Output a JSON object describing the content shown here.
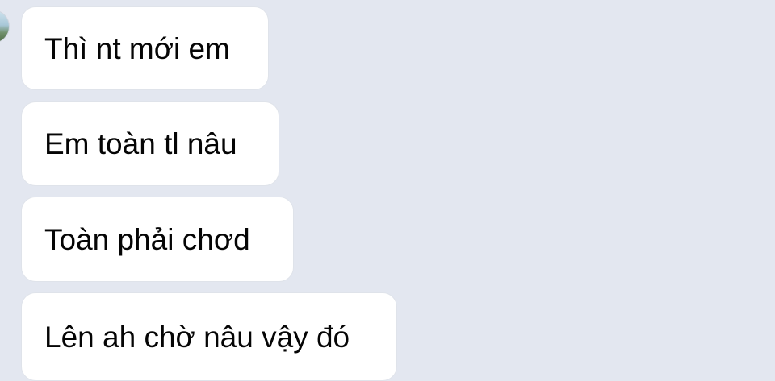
{
  "messages": [
    {
      "text": "Thì nt mới em"
    },
    {
      "text": "Em toàn tl nâu"
    },
    {
      "text": "Toàn phải chơd"
    },
    {
      "text": "Lên ah chờ nâu vậy đó"
    }
  ],
  "colors": {
    "background": "#e3e7f0",
    "bubble": "#ffffff",
    "text": "#050505"
  }
}
